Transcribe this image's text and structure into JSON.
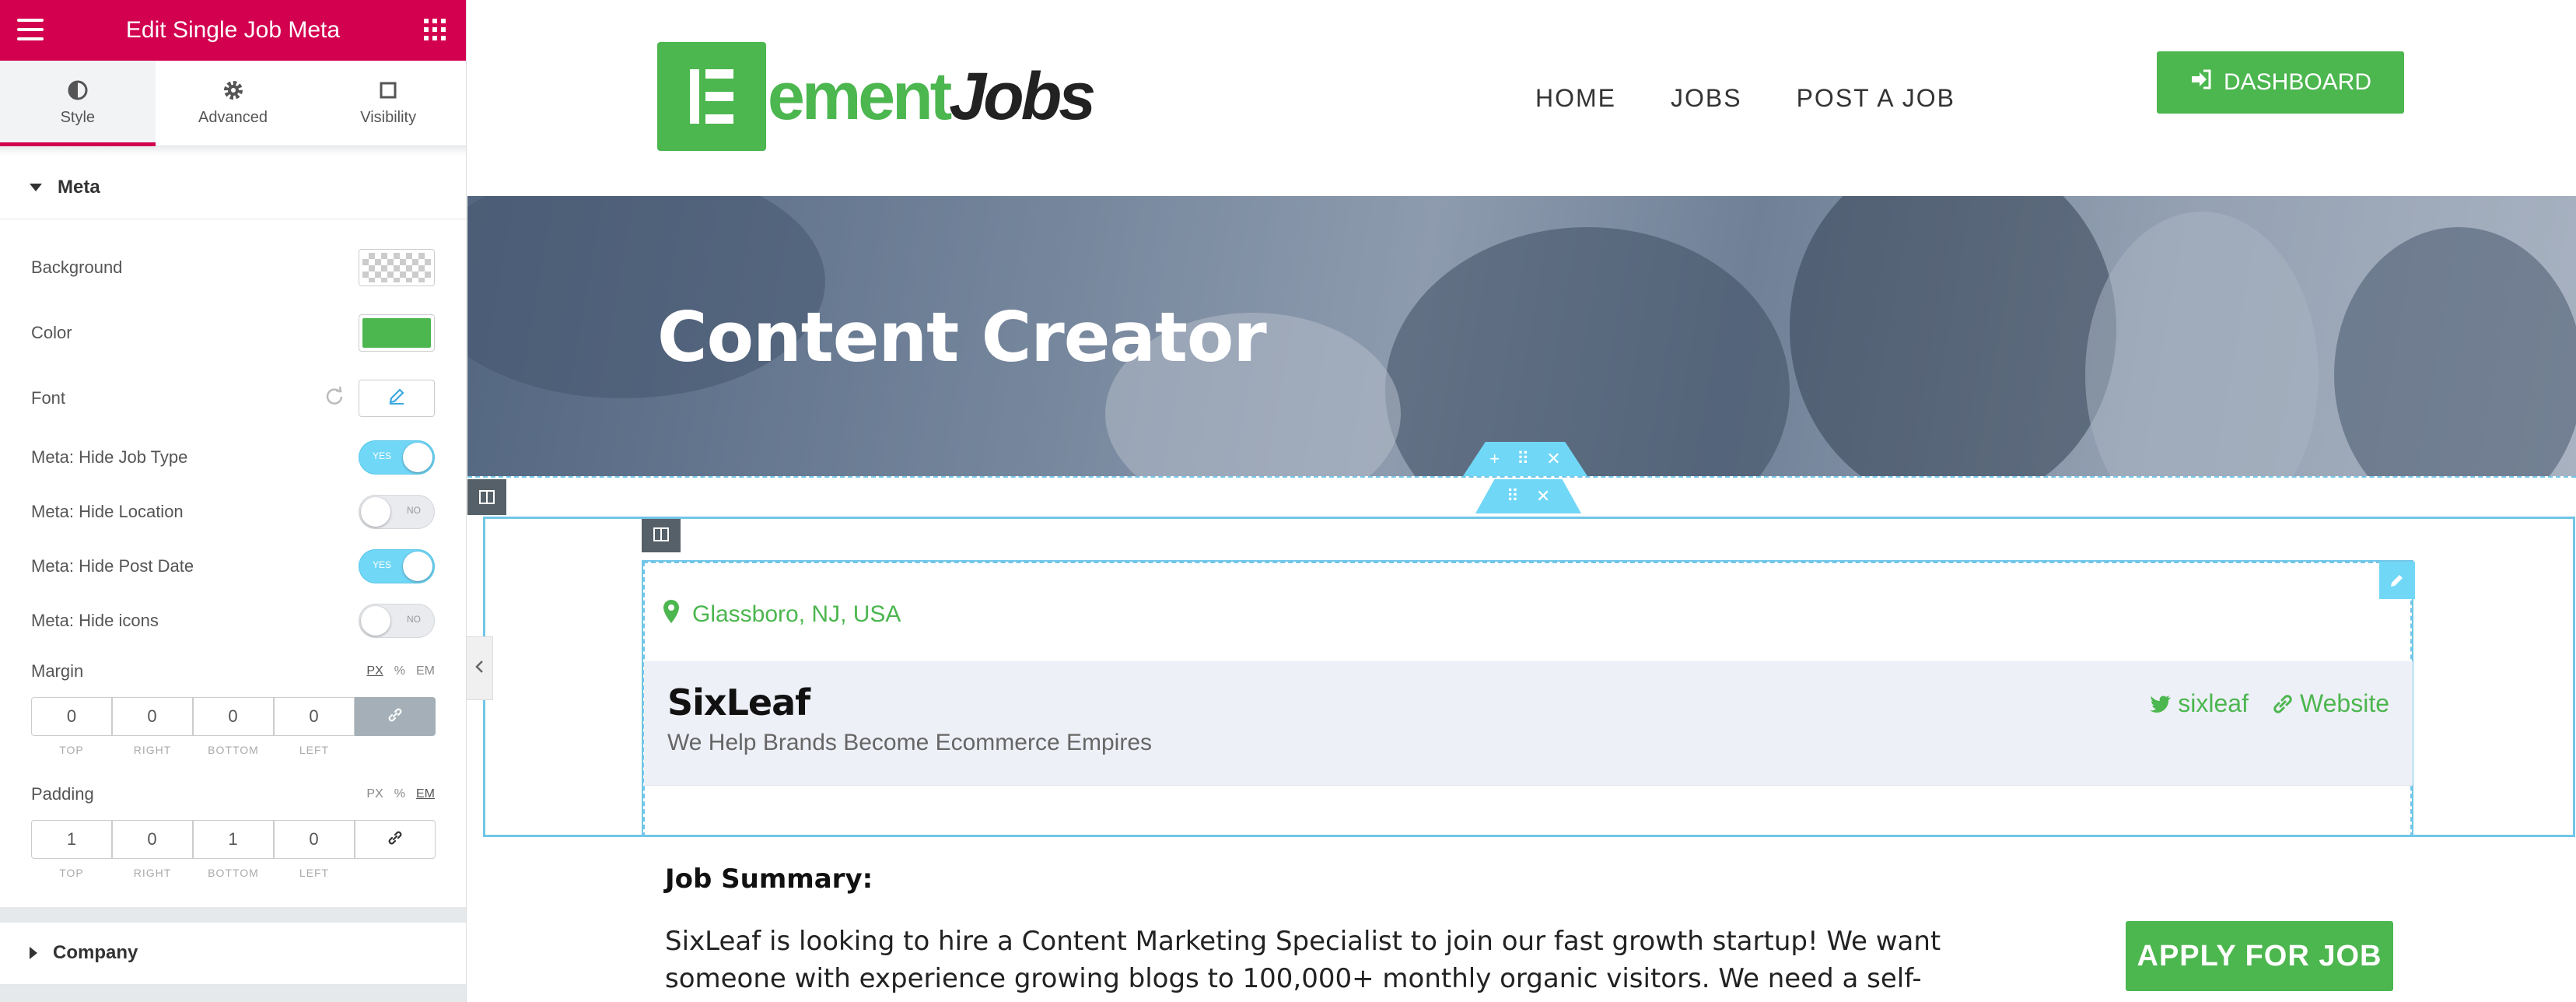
{
  "panel": {
    "title": "Edit Single Job Meta",
    "tabs": [
      {
        "label": "Style"
      },
      {
        "label": "Advanced"
      },
      {
        "label": "Visibility"
      }
    ],
    "section_meta": "Meta",
    "section_company": "Company",
    "background_label": "Background",
    "color_label": "Color",
    "color_value": "#4cb64f",
    "font_label": "Font",
    "toggles": [
      {
        "label": "Meta: Hide Job Type",
        "state": "YES"
      },
      {
        "label": "Meta: Hide Location",
        "state": "NO"
      },
      {
        "label": "Meta: Hide Post Date",
        "state": "YES"
      },
      {
        "label": "Meta: Hide icons",
        "state": "NO"
      }
    ],
    "margin": {
      "label": "Margin",
      "units": [
        "PX",
        "%",
        "EM"
      ],
      "values": [
        "0",
        "0",
        "0",
        "0"
      ],
      "sides": [
        "TOP",
        "RIGHT",
        "BOTTOM",
        "LEFT"
      ]
    },
    "padding": {
      "label": "Padding",
      "units": [
        "PX",
        "%",
        "EM"
      ],
      "values": [
        "1",
        "0",
        "1",
        "0"
      ],
      "sides": [
        "TOP",
        "RIGHT",
        "BOTTOM",
        "LEFT"
      ]
    }
  },
  "site": {
    "logo_part1": "ement",
    "logo_part2": "Jobs",
    "nav": [
      {
        "label": "HOME"
      },
      {
        "label": "JOBS"
      },
      {
        "label": "POST A JOB"
      }
    ],
    "dashboard_label": "DASHBOARD",
    "accent": "#4cb64f"
  },
  "job": {
    "title": "Content Creator",
    "location": "Glassboro, NJ, USA",
    "company_name": "SixLeaf",
    "company_tagline": "We Help Brands Become Ecommerce Empires",
    "twitter": "sixleaf",
    "website": "Website",
    "summary_heading": "Job Summary:",
    "summary_text": "SixLeaf is looking to hire a Content Marketing Specialist to join our fast growth startup! We want someone with experience growing blogs to 100,000+ monthly organic visitors. We need a self-starter, who knows exactly how",
    "apply_label": "APPLY FOR JOB"
  }
}
